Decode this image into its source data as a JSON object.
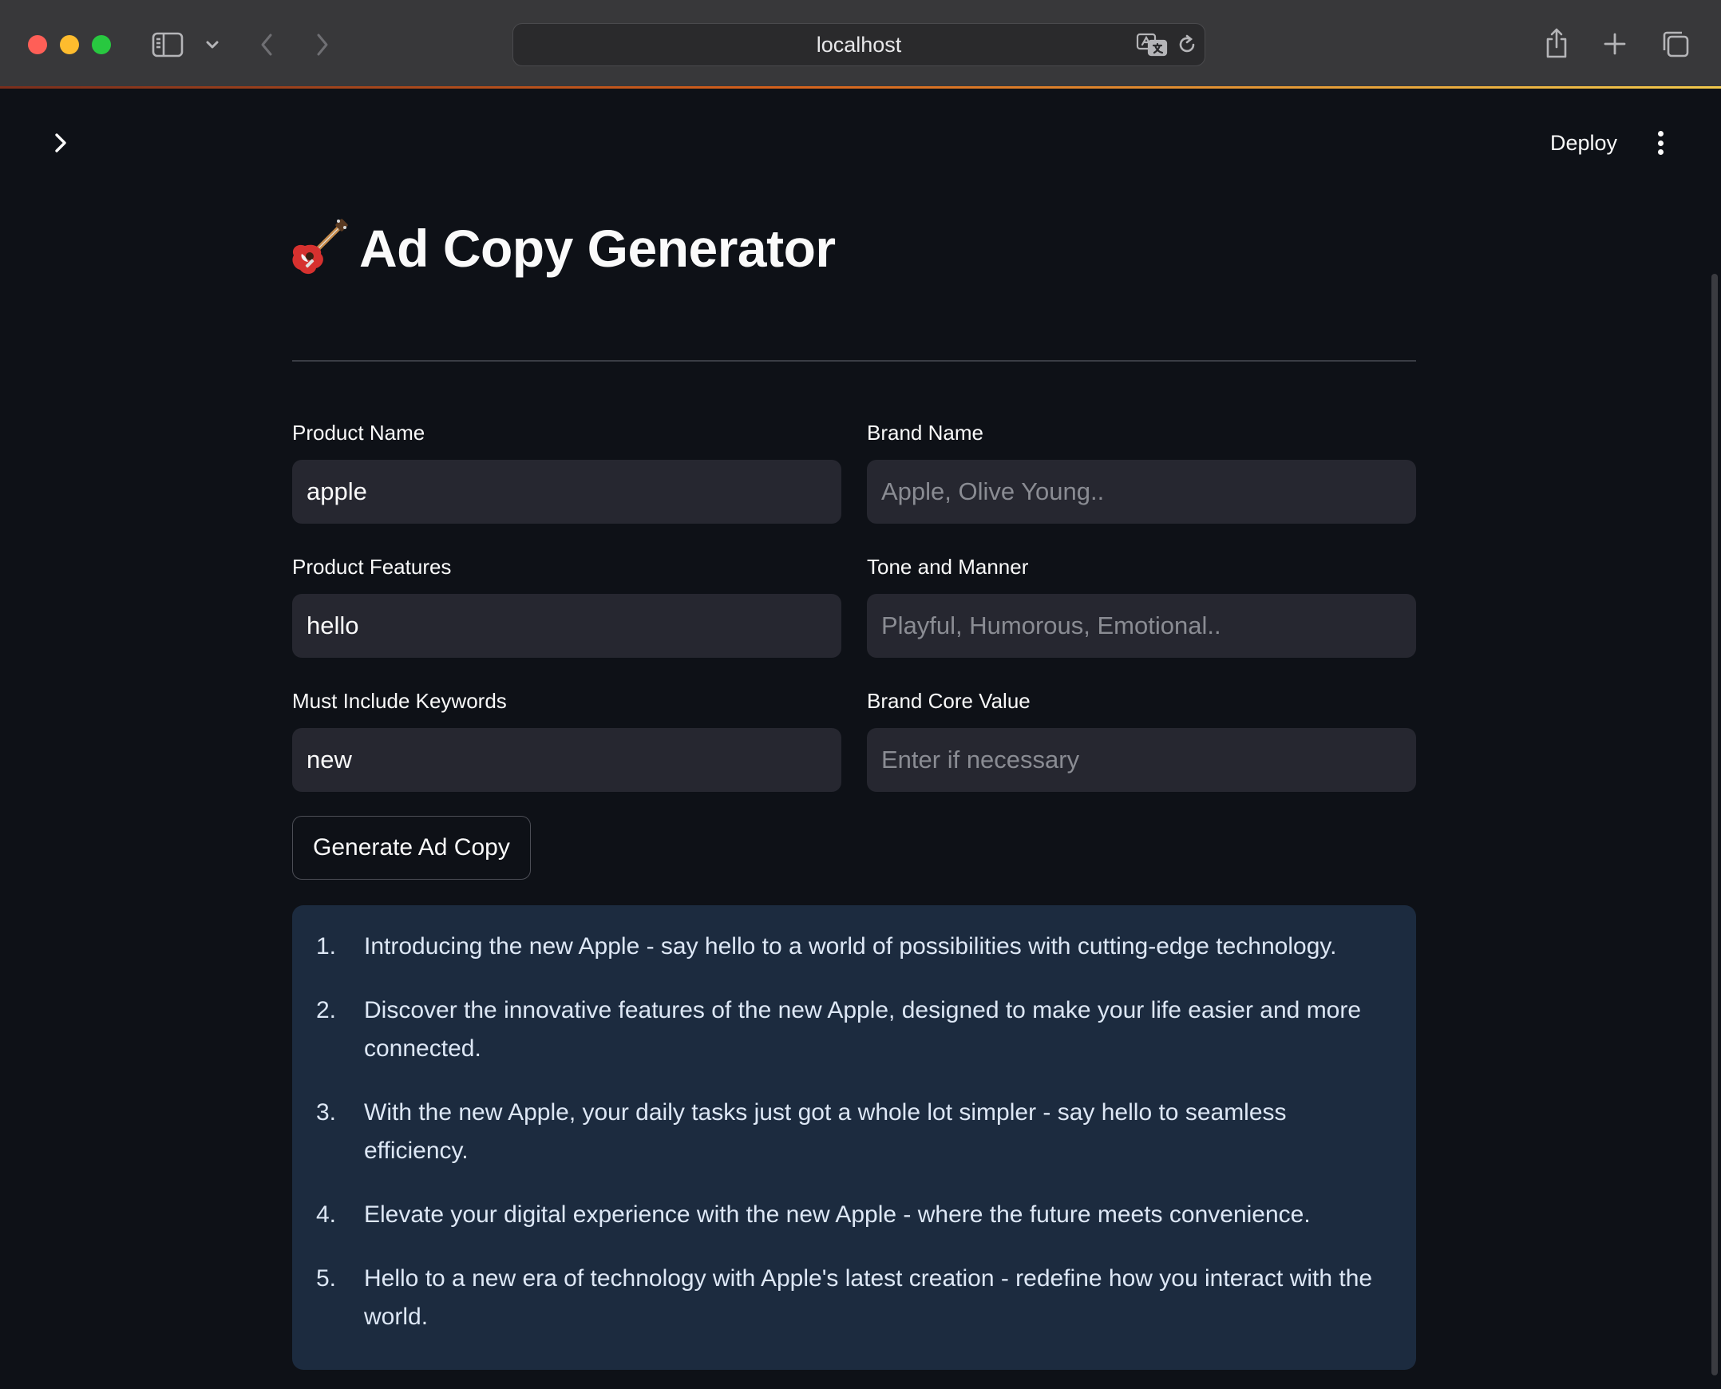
{
  "browser": {
    "url": "localhost"
  },
  "app": {
    "toolbar": {
      "deploy_label": "Deploy"
    },
    "title": "Ad Copy Generator",
    "title_icon": "guitar-emoji",
    "form": {
      "product_name": {
        "label": "Product Name",
        "value": "apple",
        "placeholder": ""
      },
      "brand_name": {
        "label": "Brand Name",
        "value": "",
        "placeholder": "Apple, Olive Young.."
      },
      "product_features": {
        "label": "Product Features",
        "value": "hello",
        "placeholder": ""
      },
      "tone_and_manner": {
        "label": "Tone and Manner",
        "value": "",
        "placeholder": "Playful, Humorous, Emotional.."
      },
      "must_include_keywords": {
        "label": "Must Include Keywords",
        "value": "new",
        "placeholder": ""
      },
      "brand_core_value": {
        "label": "Brand Core Value",
        "value": "",
        "placeholder": "Enter if necessary"
      },
      "generate_label": "Generate Ad Copy"
    },
    "results": [
      {
        "num": "1.",
        "text": "Introducing the new Apple - say hello to a world of possibilities with cutting-edge technology."
      },
      {
        "num": "2.",
        "text": "Discover the innovative features of the new Apple, designed to make your life easier and more connected."
      },
      {
        "num": "3.",
        "text": "With the new Apple, your daily tasks just got a whole lot simpler - say hello to seamless efficiency."
      },
      {
        "num": "4.",
        "text": "Elevate your digital experience with the new Apple - where the future meets convenience."
      },
      {
        "num": "5.",
        "text": "Hello to a new era of technology with Apple's latest creation - redefine how you interact with the world."
      }
    ]
  },
  "colors": {
    "background": "#0e1117",
    "input_bg": "#262730",
    "result_bg": "#1c2b3f",
    "text": "#fafafa"
  }
}
